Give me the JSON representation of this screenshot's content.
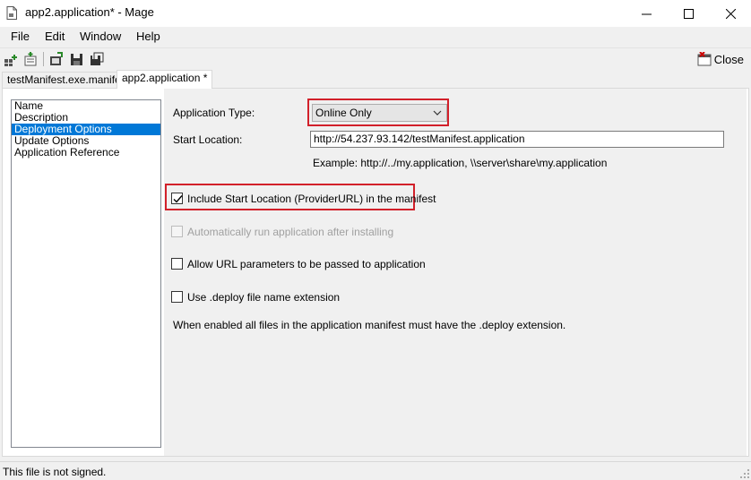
{
  "window": {
    "title": "app2.application* - Mage"
  },
  "menu": [
    "File",
    "Edit",
    "Window",
    "Help"
  ],
  "toolbar": {
    "icons": [
      "new-project-icon",
      "new-deployment-icon",
      "open-icon",
      "save-icon",
      "save-as-icon"
    ],
    "close_label": "Close"
  },
  "tabs": [
    {
      "label": "testManifest.exe.manifest",
      "active": false
    },
    {
      "label": "app2.application *",
      "active": true
    }
  ],
  "nav": {
    "items": [
      "Name",
      "Description",
      "Deployment Options",
      "Update Options",
      "Application Reference"
    ],
    "selected": "Deployment Options"
  },
  "form": {
    "app_type_label": "Application Type:",
    "app_type_value": "Online Only",
    "start_location_label": "Start Location:",
    "start_location_value": "http://54.237.93.142/testManifest.application",
    "example_text": "Example: http://../my.application, \\\\server\\share\\my.application",
    "include_start_location": {
      "label": "Include Start Location (ProviderURL) in the manifest",
      "checked": true
    },
    "auto_run": {
      "label": "Automatically run application after installing",
      "checked": false,
      "disabled": true
    },
    "allow_url_params": {
      "label": "Allow URL parameters to be passed to application",
      "checked": false
    },
    "deploy_ext": {
      "label": "Use .deploy file name extension",
      "checked": false
    },
    "deploy_note": "When enabled all files in the application manifest must have the .deploy extension."
  },
  "status": {
    "text": "This file is not signed."
  },
  "colors": {
    "highlight_box": "#d2202a",
    "selection": "#0078d7"
  }
}
